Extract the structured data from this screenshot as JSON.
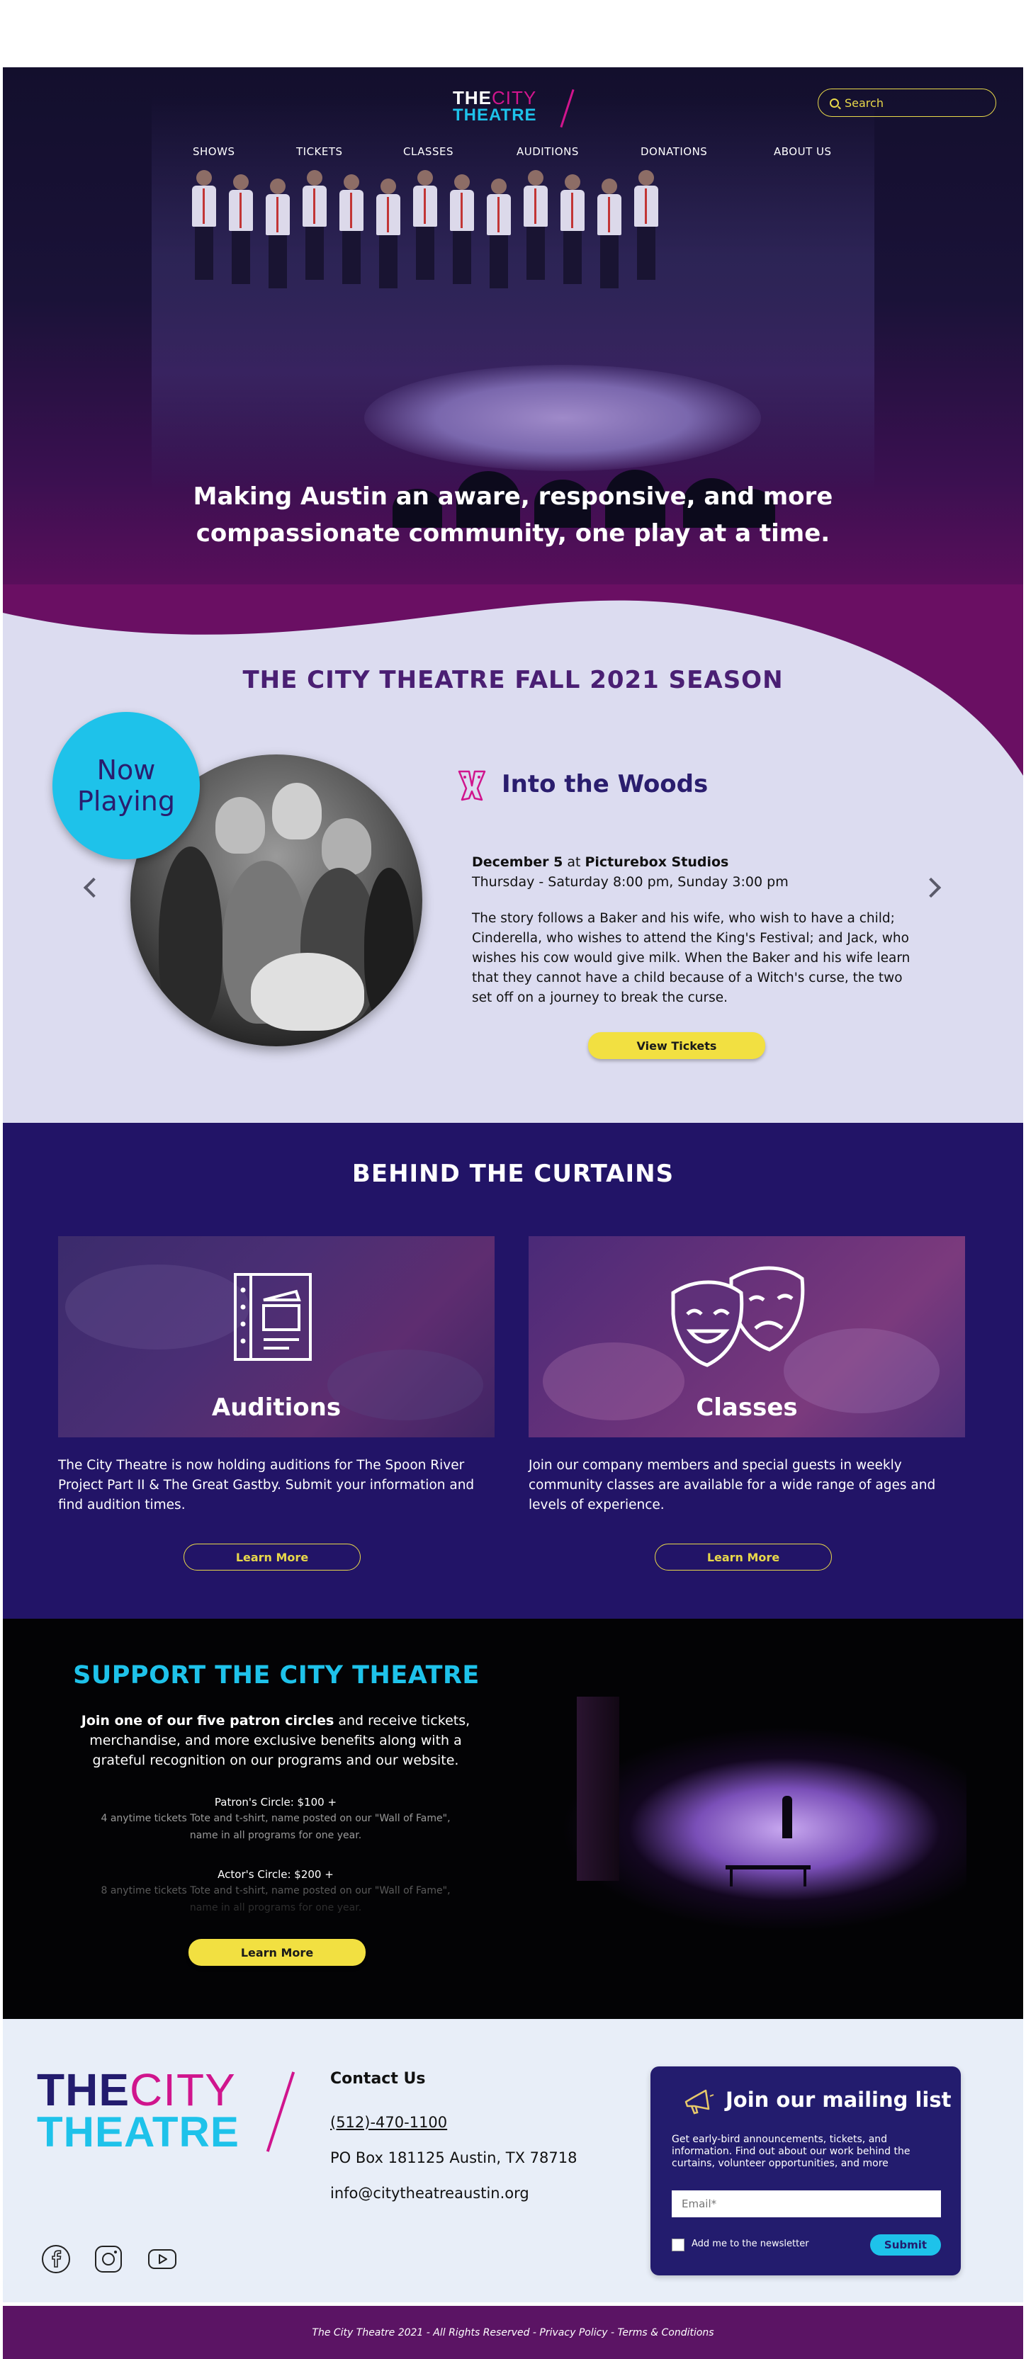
{
  "header": {
    "logo": {
      "the": "THE",
      "city": "CITY",
      "theatre": "THEATRE"
    },
    "search_placeholder": "Search",
    "nav": [
      "SHOWS",
      "TICKETS",
      "CLASSES",
      "AUDITIONS",
      "DONATIONS",
      "ABOUT US"
    ]
  },
  "hero": {
    "tagline_line1": "Making Austin an aware, responsive, and more",
    "tagline_line2": "compassionate community, one play at a time."
  },
  "season": {
    "title": "THE CITY THEATRE FALL 2021 SEASON",
    "badge_line1": "Now",
    "badge_line2": "Playing",
    "show_title": "Into the Woods",
    "date_bold": "December 5",
    "date_mid": " at ",
    "venue_bold": "Picturebox Studios",
    "times": "Thursday - Saturday 8:00 pm, Sunday 3:00 pm",
    "description": "The story follows a Baker and his wife, who wish to have a child; Cinderella, who wishes to attend the King's Festival; and Jack, who wishes his cow would give milk. When the Baker and his wife learn that they cannot have a child because of a Witch's curse, the two set off on a journey to break the curse.",
    "button": "View Tickets"
  },
  "behind": {
    "title": "BEHIND THE CURTAINS",
    "cards": [
      {
        "label": "Auditions",
        "text": "The City Theatre is now holding auditions for The Spoon River Project Part II & The Great Gastby. Submit your information and find audition times.",
        "button": "Learn More"
      },
      {
        "label": "Classes",
        "text": "Join our company members and special guests in weekly community classes are available for a wide range of ages and levels of experience.",
        "button": "Learn More"
      }
    ]
  },
  "support": {
    "title": "SUPPORT THE CITY THEATRE",
    "intro_bold": "Join one of our five patron circles",
    "intro_rest": " and receive tickets, merchandise, and more exclusive benefits along with a grateful recognition on our programs and our website.",
    "tiers": [
      {
        "name": "Patron's Circle: $100 +",
        "desc1": "4 anytime tickets Tote and t-shirt, name posted on our \"Wall of Fame\",",
        "desc2": "name in all programs for one year."
      },
      {
        "name": "Actor's Circle: $200 +",
        "desc1": "8 anytime tickets Tote and t-shirt, name posted on our \"Wall of Fame\",",
        "desc2": "name in all programs for one year."
      }
    ],
    "button": "Learn More"
  },
  "footer": {
    "contact_heading": "Contact Us",
    "phone": "(512)-470-1100",
    "address": "PO Box 181125 Austin, TX 78718",
    "email": "info@citytheatreaustin.org",
    "mailing": {
      "title": "Join our mailing list",
      "description": "Get early-bird announcements, tickets, and information. Find out about our work behind the curtains, volunteer opportunities, and more",
      "email_placeholder": "Email*",
      "checkbox_label": "Add me to the newsletter",
      "submit": "Submit"
    },
    "copyright": "The City Theatre 2021 - All Rights Reserved - Privacy Policy - Terms & Conditions"
  },
  "colors": {
    "navy": "#231c6e",
    "magenta": "#d0158d",
    "cyan": "#1ec2ea",
    "yellow": "#f2e041",
    "plum": "#5b1464",
    "lavender": "#dcdcf0"
  }
}
